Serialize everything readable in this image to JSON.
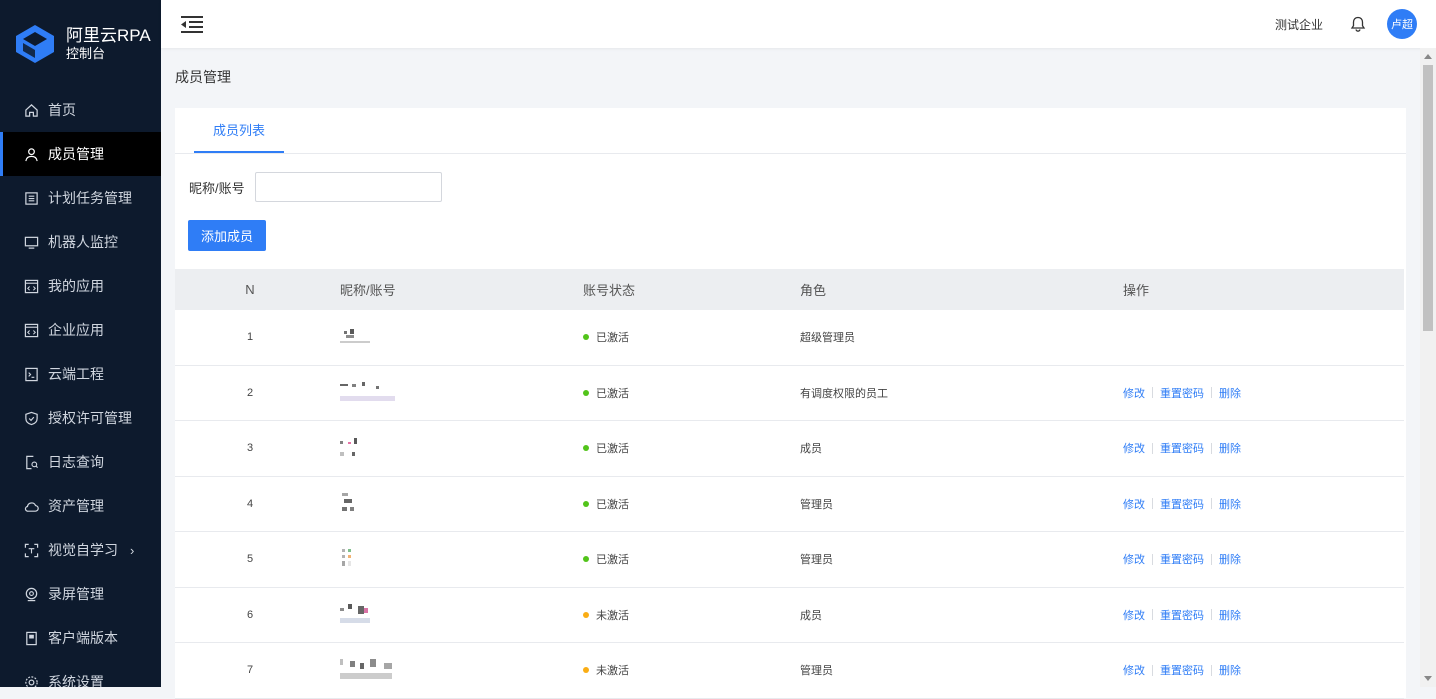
{
  "brand": {
    "title": "阿里云RPA",
    "subtitle": "控制台"
  },
  "sidebar": {
    "items": [
      {
        "label": "首页",
        "icon": "home-icon"
      },
      {
        "label": "成员管理",
        "icon": "user-icon"
      },
      {
        "label": "计划任务管理",
        "icon": "list-icon"
      },
      {
        "label": "机器人监控",
        "icon": "monitor-icon"
      },
      {
        "label": "我的应用",
        "icon": "code-window-icon"
      },
      {
        "label": "企业应用",
        "icon": "code-window-icon"
      },
      {
        "label": "云端工程",
        "icon": "cloud-project-icon"
      },
      {
        "label": "授权许可管理",
        "icon": "shield-icon"
      },
      {
        "label": "日志查询",
        "icon": "log-search-icon"
      },
      {
        "label": "资产管理",
        "icon": "cloud-icon"
      },
      {
        "label": "视觉自学习",
        "icon": "scan-icon"
      },
      {
        "label": "录屏管理",
        "icon": "record-icon"
      },
      {
        "label": "客户端版本",
        "icon": "client-icon"
      },
      {
        "label": "系统设置",
        "icon": "settings-icon"
      }
    ],
    "active_index": 1,
    "expandable_arrow": "›"
  },
  "header": {
    "company": "测试企业",
    "avatar_text": "卢超"
  },
  "page": {
    "title": "成员管理"
  },
  "tabs": [
    {
      "label": "成员列表"
    }
  ],
  "filter": {
    "label": "昵称/账号",
    "value": "",
    "placeholder": ""
  },
  "add_button": "添加成员",
  "table": {
    "columns": [
      "N",
      "昵称/账号",
      "账号状态",
      "角色",
      "操作"
    ],
    "rows": [
      {
        "n": "1",
        "status": "已激活",
        "status_color": "#52c41a",
        "role": "超级管理员",
        "ops": []
      },
      {
        "n": "2",
        "status": "已激活",
        "status_color": "#52c41a",
        "role": "有调度权限的员工",
        "ops": [
          "修改",
          "重置密码",
          "删除"
        ]
      },
      {
        "n": "3",
        "status": "已激活",
        "status_color": "#52c41a",
        "role": "成员",
        "ops": [
          "修改",
          "重置密码",
          "删除"
        ]
      },
      {
        "n": "4",
        "status": "已激活",
        "status_color": "#52c41a",
        "role": "管理员",
        "ops": [
          "修改",
          "重置密码",
          "删除"
        ]
      },
      {
        "n": "5",
        "status": "已激活",
        "status_color": "#52c41a",
        "role": "管理员",
        "ops": [
          "修改",
          "重置密码",
          "删除"
        ]
      },
      {
        "n": "6",
        "status": "未激活",
        "status_color": "#faad14",
        "role": "成员",
        "ops": [
          "修改",
          "重置密码",
          "删除"
        ]
      },
      {
        "n": "7",
        "status": "未激活",
        "status_color": "#faad14",
        "role": "管理员",
        "ops": [
          "修改",
          "重置密码",
          "删除"
        ]
      }
    ]
  },
  "colors": {
    "accent": "#2f7df6",
    "sidebar_bg": "#0d1a2d",
    "active_status": "#52c41a",
    "inactive_status": "#faad14"
  }
}
